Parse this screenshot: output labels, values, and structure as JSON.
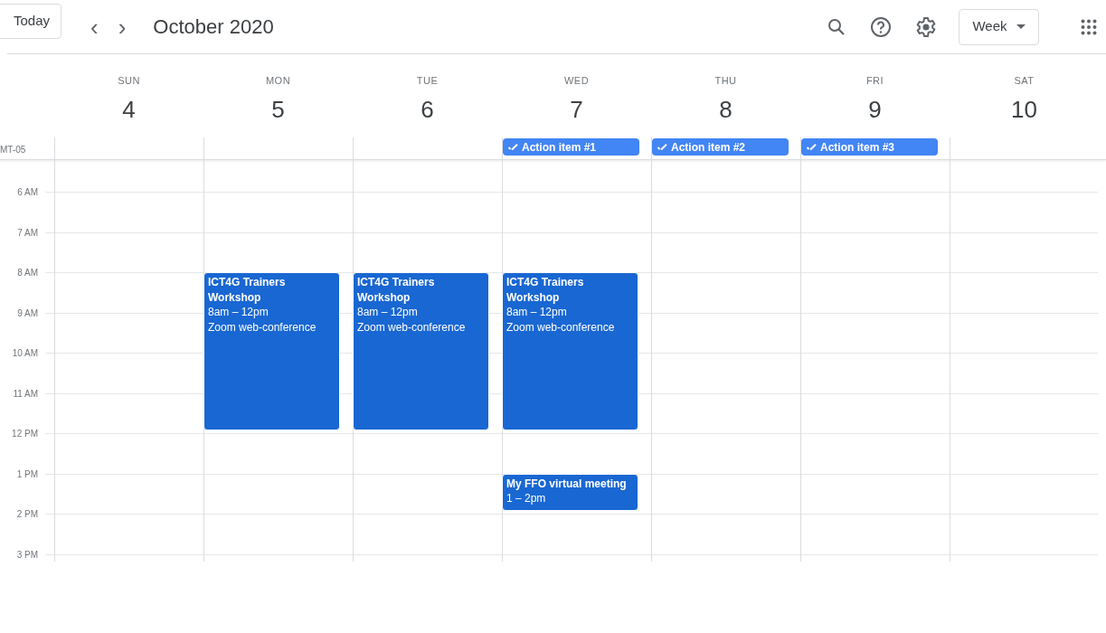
{
  "toolbar": {
    "today_button": "Today",
    "prev": "‹",
    "next": "›",
    "title": "October 2020",
    "view_dropdown": "Week"
  },
  "timezone": "MT-05",
  "hours": [
    "6 AM",
    "7 AM",
    "8 AM",
    "9 AM",
    "10 AM",
    "11 AM",
    "12 PM",
    "1 PM",
    "2 PM",
    "3 PM"
  ],
  "days": [
    {
      "weekday": "SUN",
      "date": "4"
    },
    {
      "weekday": "MON",
      "date": "5",
      "events": [
        {
          "title": "ICT4G Trainers Workshop",
          "time": "8am – 12pm",
          "location": "Zoom web-conference"
        }
      ]
    },
    {
      "weekday": "TUE",
      "date": "6",
      "events": [
        {
          "title": "ICT4G Trainers Workshop",
          "time": "8am – 12pm",
          "location": "Zoom web-conference"
        }
      ]
    },
    {
      "weekday": "WED",
      "date": "7",
      "all_day": [
        {
          "title": "Action item #1"
        }
      ],
      "events": [
        {
          "title": "ICT4G Trainers Workshop",
          "time": "8am – 12pm",
          "location": "Zoom web-conference"
        },
        {
          "title": "My FFO virtual meeting",
          "time": "1 – 2pm"
        }
      ]
    },
    {
      "weekday": "THU",
      "date": "8",
      "all_day": [
        {
          "title": "Action item #2"
        }
      ]
    },
    {
      "weekday": "FRI",
      "date": "9",
      "all_day": [
        {
          "title": "Action item #3"
        }
      ]
    },
    {
      "weekday": "SAT",
      "date": "10"
    }
  ]
}
